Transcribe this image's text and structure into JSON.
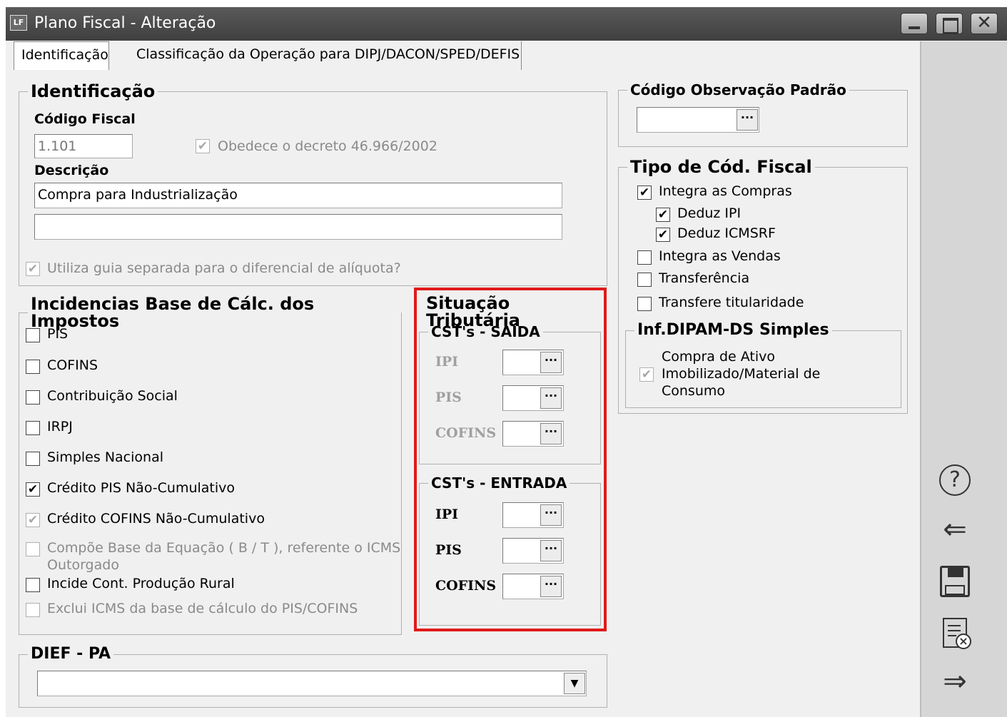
{
  "window": {
    "icon_text": "LF",
    "title": "Plano Fiscal - Alteração",
    "controls": [
      "minimize-icon",
      "maximize-icon",
      "close-icon"
    ],
    "close_glyph": "✕"
  },
  "tabs": [
    {
      "label": "Identificação",
      "active": true
    },
    {
      "label": "Classificação da Operação para DIPJ/DACON/SPED/DEFIS",
      "active": false
    }
  ],
  "identificacao": {
    "legend": "Identificação",
    "codigo_fiscal_label": "Código Fiscal",
    "codigo_fiscal_value": "1.101",
    "decreto_label": "Obedece o decreto 46.966/2002",
    "decreto_checked": true,
    "descricao_label": "Descrição",
    "descricao_line1": "Compra para Industrialização",
    "descricao_line2": "",
    "guia_label": "Utiliza guia separada para o diferencial de alíquota?",
    "guia_checked": true
  },
  "incidencias": {
    "legend": "Incidencias Base de Cálc. dos Impostos",
    "items": [
      {
        "label": "PIS",
        "checked": false,
        "enabled": true
      },
      {
        "label": "COFINS",
        "checked": false,
        "enabled": true
      },
      {
        "label": "Contribuição Social",
        "checked": false,
        "enabled": true
      },
      {
        "label": "IRPJ",
        "checked": false,
        "enabled": true
      },
      {
        "label": "Simples Nacional",
        "checked": false,
        "enabled": true
      },
      {
        "label": "Crédito PIS Não-Cumulativo",
        "checked": true,
        "enabled": true
      },
      {
        "label": "Crédito COFINS Não-Cumulativo",
        "checked": true,
        "enabled": true
      },
      {
        "label": "Compõe Base da Equação ( B / T ), referente o ICMS",
        "label2": "Outorgado",
        "checked": false,
        "enabled": false
      },
      {
        "label": "Incide Cont. Produção Rural",
        "checked": false,
        "enabled": true
      },
      {
        "label": "Exclui ICMS da base de cálculo do PIS/COFINS",
        "checked": false,
        "enabled": false
      }
    ]
  },
  "situacao": {
    "legend": "Situação Tributária",
    "saida": {
      "legend": "CST's - SAÍDA",
      "fields": [
        {
          "label": "IPI",
          "value": ""
        },
        {
          "label": "PIS",
          "value": ""
        },
        {
          "label": "COFINS",
          "value": ""
        }
      ]
    },
    "entrada": {
      "legend": "CST's - ENTRADA",
      "fields": [
        {
          "label": "IPI",
          "value": ""
        },
        {
          "label": "PIS",
          "value": ""
        },
        {
          "label": "COFINS",
          "value": ""
        }
      ]
    },
    "lookup_glyph": "···",
    "highlight_color": "#e01a1a"
  },
  "dief": {
    "legend": "DIEF - PA",
    "value": "",
    "arrow": "▼"
  },
  "codigo_obs": {
    "legend": "Código Observação Padrão",
    "value": ""
  },
  "tipo_cod": {
    "legend": "Tipo de Cód. Fiscal",
    "items": [
      {
        "label": "Integra as Compras",
        "checked": true
      },
      {
        "label": "Deduz IPI",
        "checked": true
      },
      {
        "label": "Deduz ICMSRF",
        "checked": true
      },
      {
        "label": "Integra as Vendas",
        "checked": false
      },
      {
        "label": "Transferência",
        "checked": false
      },
      {
        "label": "Transfere titularidade",
        "checked": false
      }
    ]
  },
  "dipam": {
    "legend": "Inf.DIPAM-DS Simples",
    "label_lines": [
      "Compra de Ativo",
      "Imobilizado/Material de",
      "Consumo"
    ],
    "checked": true
  },
  "side_toolbar": [
    {
      "name": "help-icon",
      "glyph": "?"
    },
    {
      "name": "back-arrow-icon",
      "glyph": "⇐"
    },
    {
      "name": "save-icon",
      "glyph": "💾"
    },
    {
      "name": "cancel-document-icon",
      "glyph": "🗎"
    },
    {
      "name": "forward-arrow-icon",
      "glyph": "⇒"
    }
  ],
  "check_glyph": "✔"
}
